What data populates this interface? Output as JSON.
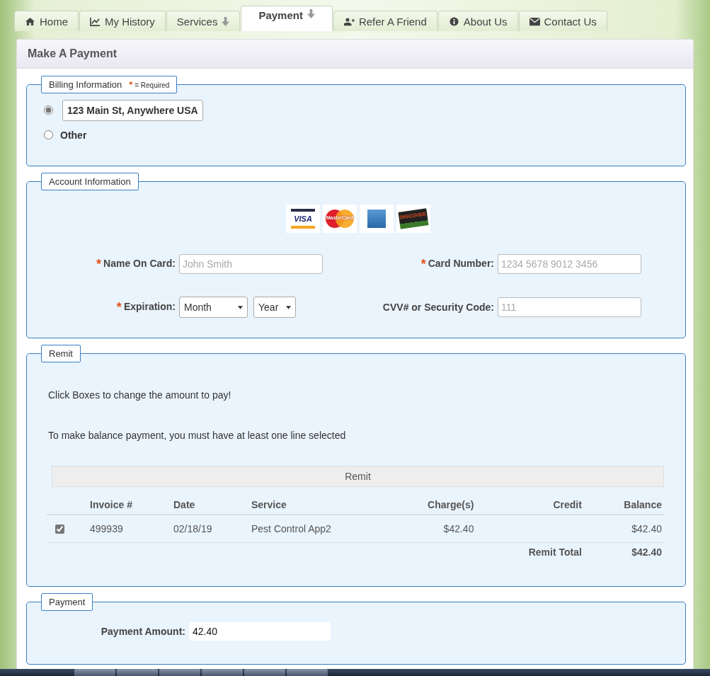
{
  "tabs": [
    {
      "label": "Home",
      "selected": false,
      "has_menu": false
    },
    {
      "label": "My History",
      "selected": false,
      "has_menu": false
    },
    {
      "label": "Services",
      "selected": false,
      "has_menu": true
    },
    {
      "label": "Payment",
      "selected": true,
      "has_menu": true
    },
    {
      "label": "Refer A Friend",
      "selected": false,
      "has_menu": false
    },
    {
      "label": "About Us",
      "selected": false,
      "has_menu": false
    },
    {
      "label": "Contact Us",
      "selected": false,
      "has_menu": false
    }
  ],
  "panel": {
    "title": "Make A Payment"
  },
  "billing": {
    "legend": "Billing Information",
    "required_mark": "*",
    "required_note": "= Required",
    "options": [
      {
        "label": "123 Main St, Anywhere USA",
        "selected": true
      },
      {
        "label": "Other",
        "selected": false
      }
    ]
  },
  "account": {
    "legend": "Account Information",
    "card_logos": [
      {
        "kind": "visa",
        "label": "VISA"
      },
      {
        "kind": "mastercard",
        "label": "MasterCard"
      },
      {
        "kind": "amex"
      },
      {
        "kind": "discover",
        "label": "DISCOVER"
      }
    ],
    "fields": [
      {
        "kind": "text",
        "label": "Name On Card:",
        "required": true,
        "placeholder": "John Smith"
      },
      {
        "kind": "text",
        "label": "Card Number:",
        "required": true,
        "placeholder": "1234 5678 9012 3456"
      },
      {
        "kind": "selects",
        "label": "Expiration:",
        "required": true,
        "selects": [
          "Month",
          "Year"
        ]
      },
      {
        "kind": "text",
        "label": "CVV# or Security Code:",
        "required": false,
        "placeholder": "111"
      }
    ]
  },
  "remit": {
    "legend": "Remit",
    "notes": [
      "Click Boxes to change the amount to pay!",
      "To make balance payment, you must have at least one line selected"
    ],
    "table": {
      "caption": "Remit",
      "columns": [
        "Invoice #",
        "Date",
        "Service",
        "Charge(s)",
        "Credit",
        "Balance"
      ],
      "rows": [
        {
          "checked": true,
          "cells": [
            "499939",
            "02/18/19",
            "Pest Control App2",
            "$42.40",
            "",
            "$42.40"
          ]
        }
      ],
      "total_label": "Remit Total",
      "total_value": "$42.40"
    }
  },
  "payment": {
    "legend": "Payment",
    "label": "Payment Amount:",
    "value": "42.40"
  }
}
